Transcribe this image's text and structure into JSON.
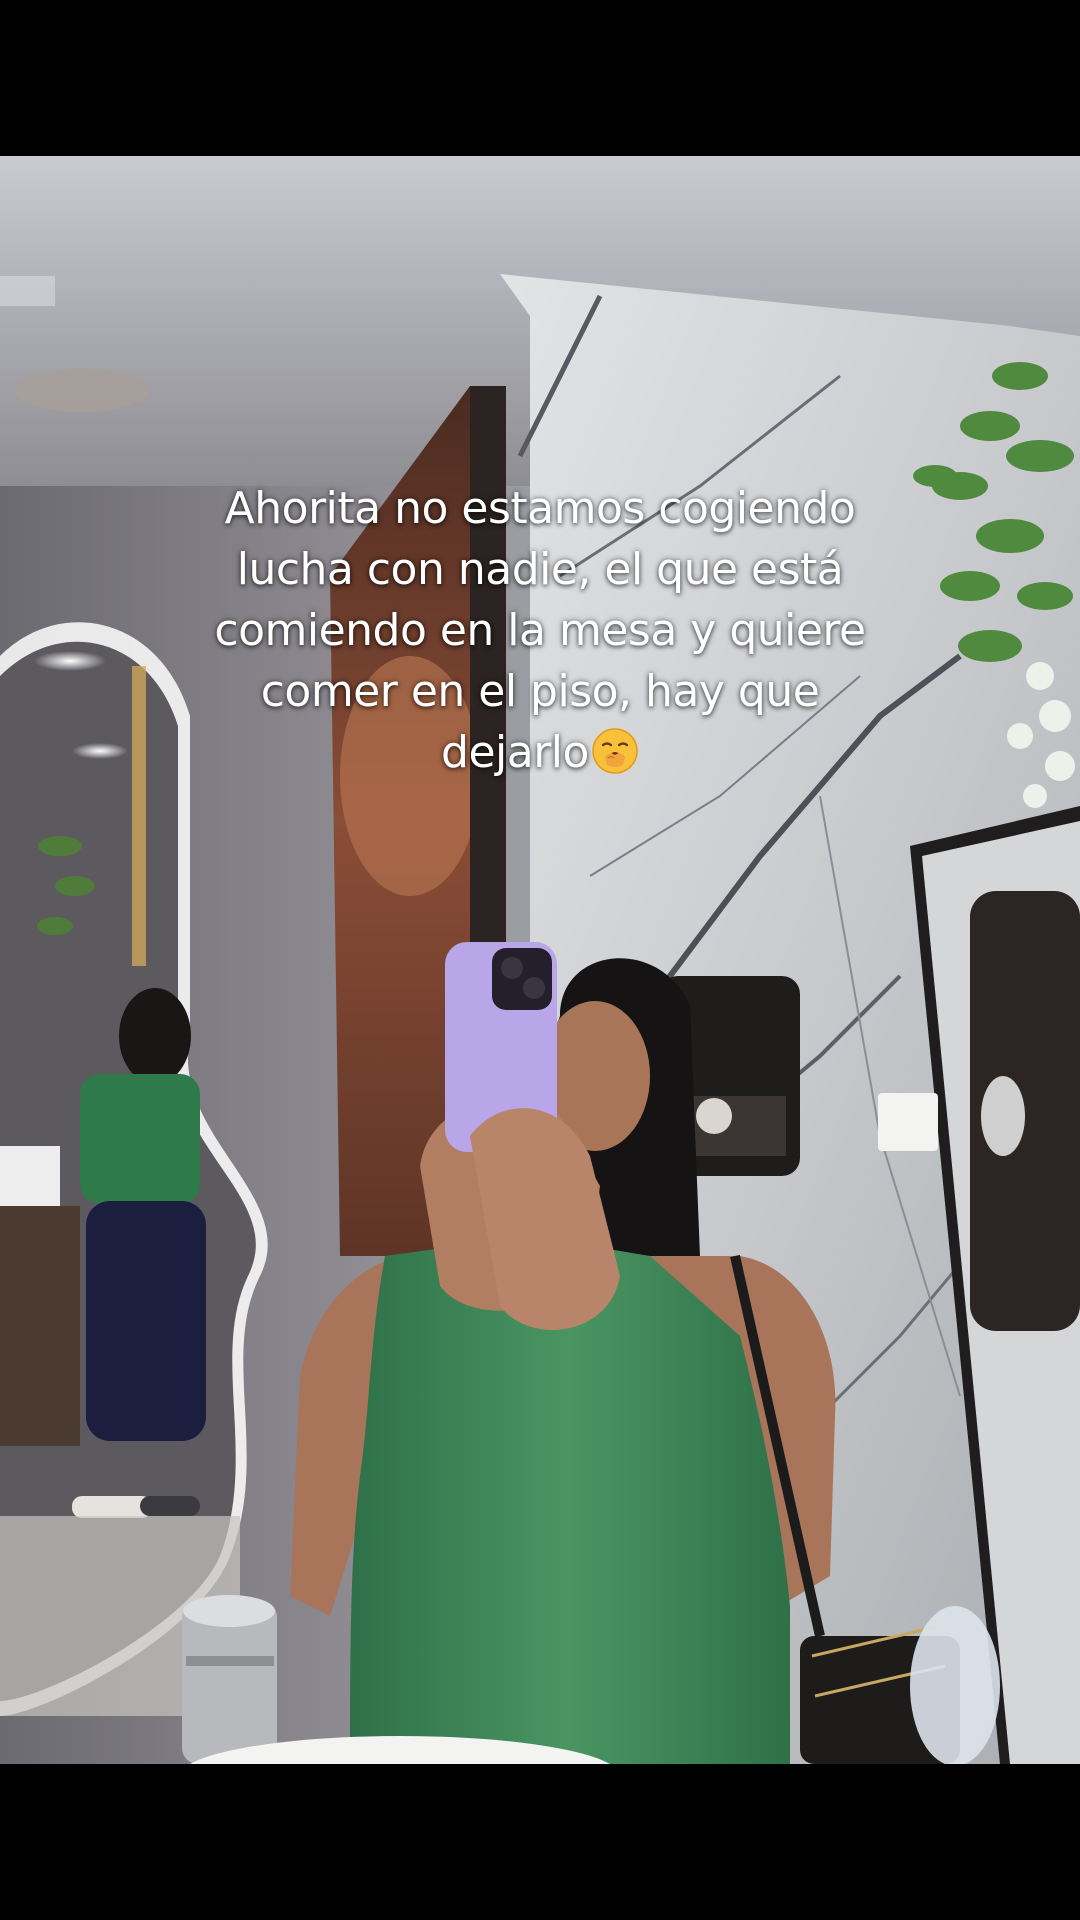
{
  "caption": {
    "line1": "Ahorita no estamos cogiendo",
    "line2": "lucha con nadie, el que está",
    "line3": "comiendo en la mesa y quiere",
    "line4": "comer en el piso, hay que",
    "line5": "dejarlo"
  },
  "icons": {
    "caption_emoji": "yawning-face-emoji"
  },
  "colors": {
    "letterbox": "#000000",
    "caption_text": "#ffffff",
    "top_color": "#3f8a57",
    "phone_case": "#b9a6e8"
  }
}
